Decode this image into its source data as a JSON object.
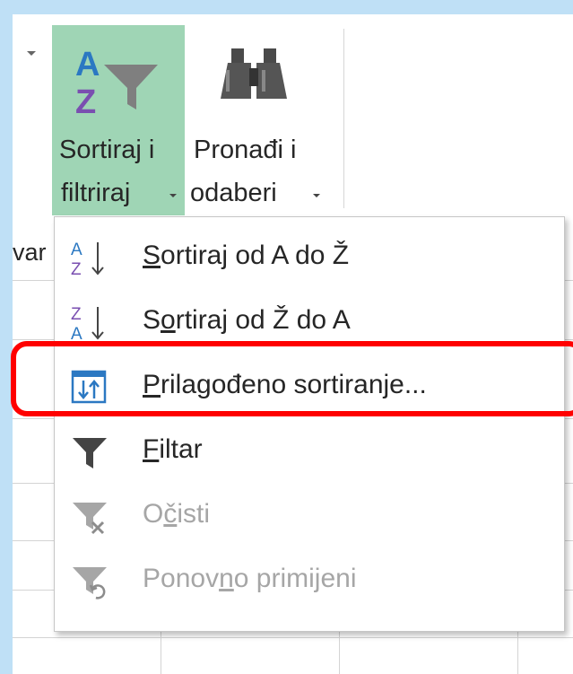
{
  "ribbon": {
    "sort_filter": {
      "line1": "Sortiraj i",
      "line2": "filtriraj"
    },
    "find_select": {
      "line1": "Pronađi i",
      "line2": "odaberi"
    },
    "left_cut_text": "var"
  },
  "menu": {
    "items": [
      {
        "pre": "",
        "ul": "S",
        "post": "ortiraj od A do Ž",
        "icon": "sort-a-z-icon",
        "enabled": true
      },
      {
        "pre": "S",
        "ul": "o",
        "post": "rtiraj od Ž do A",
        "icon": "sort-z-a-icon",
        "enabled": true
      },
      {
        "pre": "",
        "ul": "P",
        "post": "rilagođeno sortiranje...",
        "icon": "custom-sort-icon",
        "enabled": true
      },
      {
        "pre": "",
        "ul": "F",
        "post": "iltar",
        "icon": "filter-icon",
        "enabled": true
      },
      {
        "pre": "O",
        "ul": "č",
        "post": "isti",
        "icon": "clear-filter-icon",
        "enabled": false
      },
      {
        "pre": "Ponov",
        "ul": "n",
        "post": "o primijeni",
        "icon": "reapply-filter-icon",
        "enabled": false
      }
    ]
  },
  "colors": {
    "accent_button": "#9fd5b5",
    "highlight": "#ff0000",
    "window_frame": "#bfe0f6",
    "sort_icon_blue": "#2b78c2",
    "sort_icon_purple": "#7a4fb0"
  }
}
